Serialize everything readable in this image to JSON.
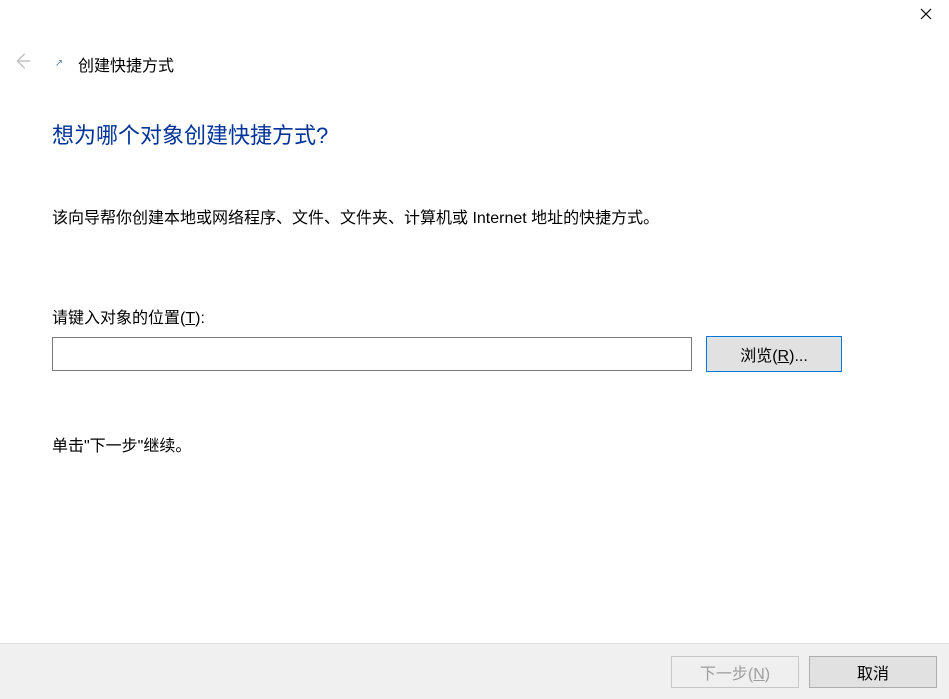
{
  "titlebar": {
    "close_icon": "close-icon"
  },
  "header": {
    "back_icon": "back-arrow-icon",
    "shortcut_icon": "shortcut-arrow-icon",
    "wizard_title": "创建快捷方式"
  },
  "content": {
    "main_question": "想为哪个对象创建快捷方式?",
    "description": "该向导帮你创建本地或网络程序、文件、文件夹、计算机或 Internet 地址的快捷方式。",
    "input_label_pre": "请键入对象的位置(",
    "input_label_key": "T",
    "input_label_post": "):",
    "location_value": "",
    "browse_pre": "浏览(",
    "browse_key": "R",
    "browse_post": ")...",
    "continue_text": "单击\"下一步\"继续。"
  },
  "footer": {
    "next_pre": "下一步(",
    "next_key": "N",
    "next_post": ")",
    "cancel": "取消"
  }
}
